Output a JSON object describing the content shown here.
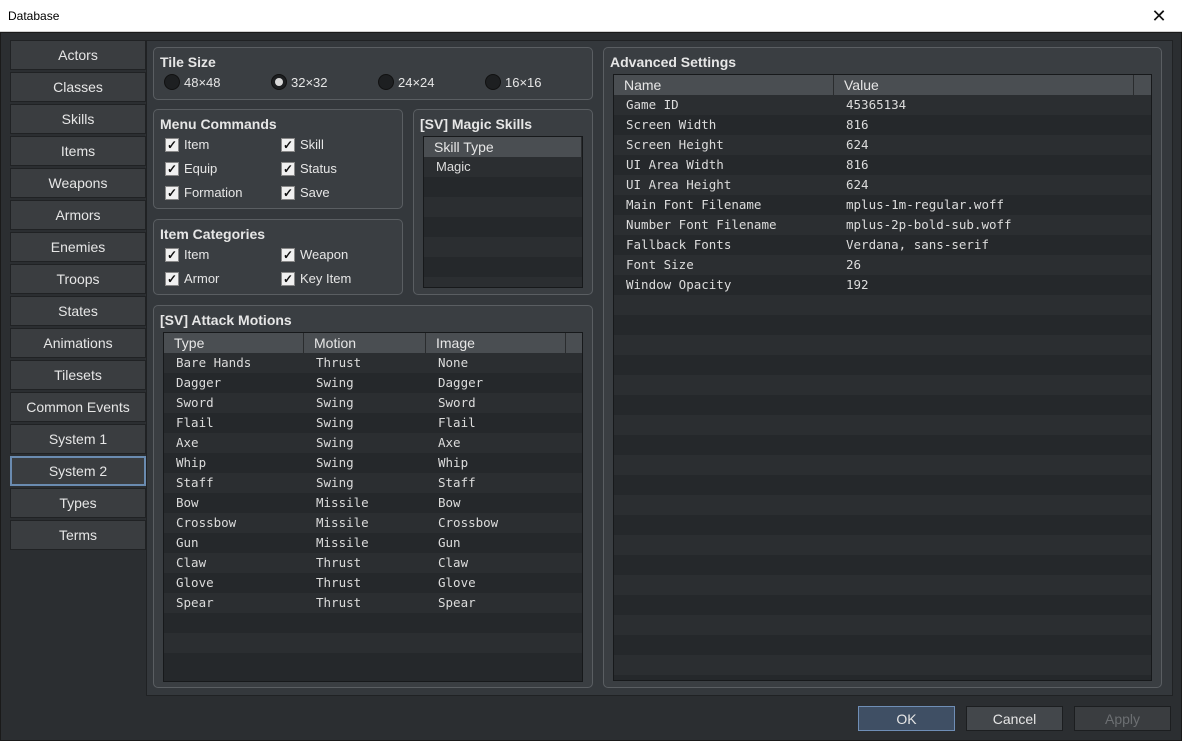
{
  "window": {
    "title": "Database",
    "close_glyph": "✕"
  },
  "sidebar": {
    "items": [
      {
        "label": "Actors"
      },
      {
        "label": "Classes"
      },
      {
        "label": "Skills"
      },
      {
        "label": "Items"
      },
      {
        "label": "Weapons"
      },
      {
        "label": "Armors"
      },
      {
        "label": "Enemies"
      },
      {
        "label": "Troops"
      },
      {
        "label": "States"
      },
      {
        "label": "Animations"
      },
      {
        "label": "Tilesets"
      },
      {
        "label": "Common Events"
      },
      {
        "label": "System 1"
      },
      {
        "label": "System 2"
      },
      {
        "label": "Types"
      },
      {
        "label": "Terms"
      }
    ],
    "active": "System 2"
  },
  "tile_size": {
    "title": "Tile Size",
    "options": [
      "48×48",
      "32×32",
      "24×24",
      "16×16"
    ],
    "selected": "32×32"
  },
  "menu_commands": {
    "title": "Menu Commands",
    "items": [
      {
        "label": "Item",
        "checked": true
      },
      {
        "label": "Skill",
        "checked": true
      },
      {
        "label": "Equip",
        "checked": true
      },
      {
        "label": "Status",
        "checked": true
      },
      {
        "label": "Formation",
        "checked": true
      },
      {
        "label": "Save",
        "checked": true
      }
    ]
  },
  "item_categories": {
    "title": "Item Categories",
    "items": [
      {
        "label": "Item",
        "checked": true
      },
      {
        "label": "Weapon",
        "checked": true
      },
      {
        "label": "Armor",
        "checked": true
      },
      {
        "label": "Key Item",
        "checked": true
      }
    ]
  },
  "magic_skills": {
    "title": "[SV] Magic Skills",
    "column": "Skill Type",
    "rows": [
      "Magic"
    ]
  },
  "attack_motions": {
    "title": "[SV] Attack Motions",
    "columns": [
      "Type",
      "Motion",
      "Image"
    ],
    "rows": [
      [
        "Bare Hands",
        "Thrust",
        "None"
      ],
      [
        "Dagger",
        "Swing",
        "Dagger"
      ],
      [
        "Sword",
        "Swing",
        "Sword"
      ],
      [
        "Flail",
        "Swing",
        "Flail"
      ],
      [
        "Axe",
        "Swing",
        "Axe"
      ],
      [
        "Whip",
        "Swing",
        "Whip"
      ],
      [
        "Staff",
        "Swing",
        "Staff"
      ],
      [
        "Bow",
        "Missile",
        "Bow"
      ],
      [
        "Crossbow",
        "Missile",
        "Crossbow"
      ],
      [
        "Gun",
        "Missile",
        "Gun"
      ],
      [
        "Claw",
        "Thrust",
        "Claw"
      ],
      [
        "Glove",
        "Thrust",
        "Glove"
      ],
      [
        "Spear",
        "Thrust",
        "Spear"
      ]
    ]
  },
  "advanced_settings": {
    "title": "Advanced Settings",
    "columns": [
      "Name",
      "Value"
    ],
    "rows": [
      [
        "Game ID",
        "45365134"
      ],
      [
        "Screen Width",
        "816"
      ],
      [
        "Screen Height",
        "624"
      ],
      [
        "UI Area Width",
        "816"
      ],
      [
        "UI Area Height",
        "624"
      ],
      [
        "Main Font Filename",
        "mplus-1m-regular.woff"
      ],
      [
        "Number Font Filename",
        "mplus-2p-bold-sub.woff"
      ],
      [
        "Fallback Fonts",
        "Verdana, sans-serif"
      ],
      [
        "Font Size",
        "26"
      ],
      [
        "Window Opacity",
        "192"
      ]
    ]
  },
  "buttons": {
    "ok": "OK",
    "cancel": "Cancel",
    "apply": "Apply"
  }
}
